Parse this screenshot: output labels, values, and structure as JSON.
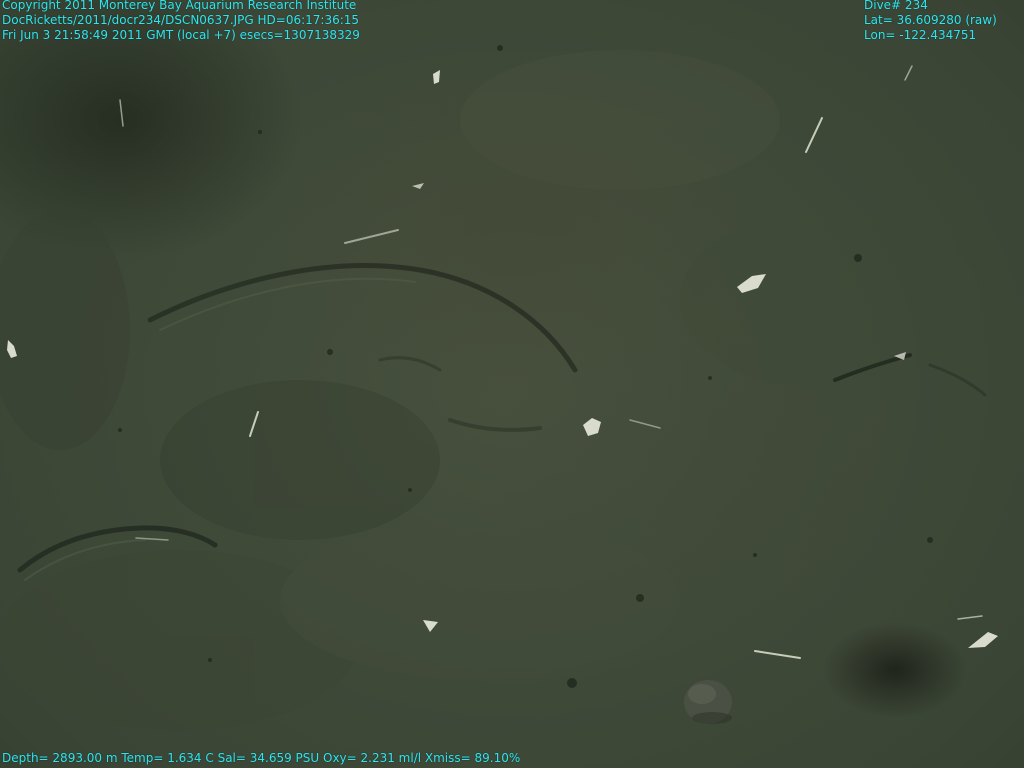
{
  "overlay": {
    "top_left": {
      "copyright": "Copyright 2011 Monterey Bay Aquarium Research Institute",
      "file_line": "DocRicketts/2011/docr234/DSCN0637.JPG   HD=06:17:36:15",
      "time_line": "Fri Jun  3 21:58:49 2011 GMT (local +7)  esecs=1307138329"
    },
    "top_right": {
      "dive": "Dive# 234",
      "lat": "Lat= 36.609280 (raw)",
      "lon": "Lon= -122.434751"
    },
    "bottom": {
      "sensors": "Depth= 2893.00 m  Temp= 1.634 C  Sal= 34.659 PSU  Oxy= 2.231 ml/l  Xmiss= 89.10%"
    },
    "text_color": "#2ee6f0"
  },
  "scene": {
    "subject": "deep-sea sediment floor",
    "dominant_color": "#3f4937"
  }
}
